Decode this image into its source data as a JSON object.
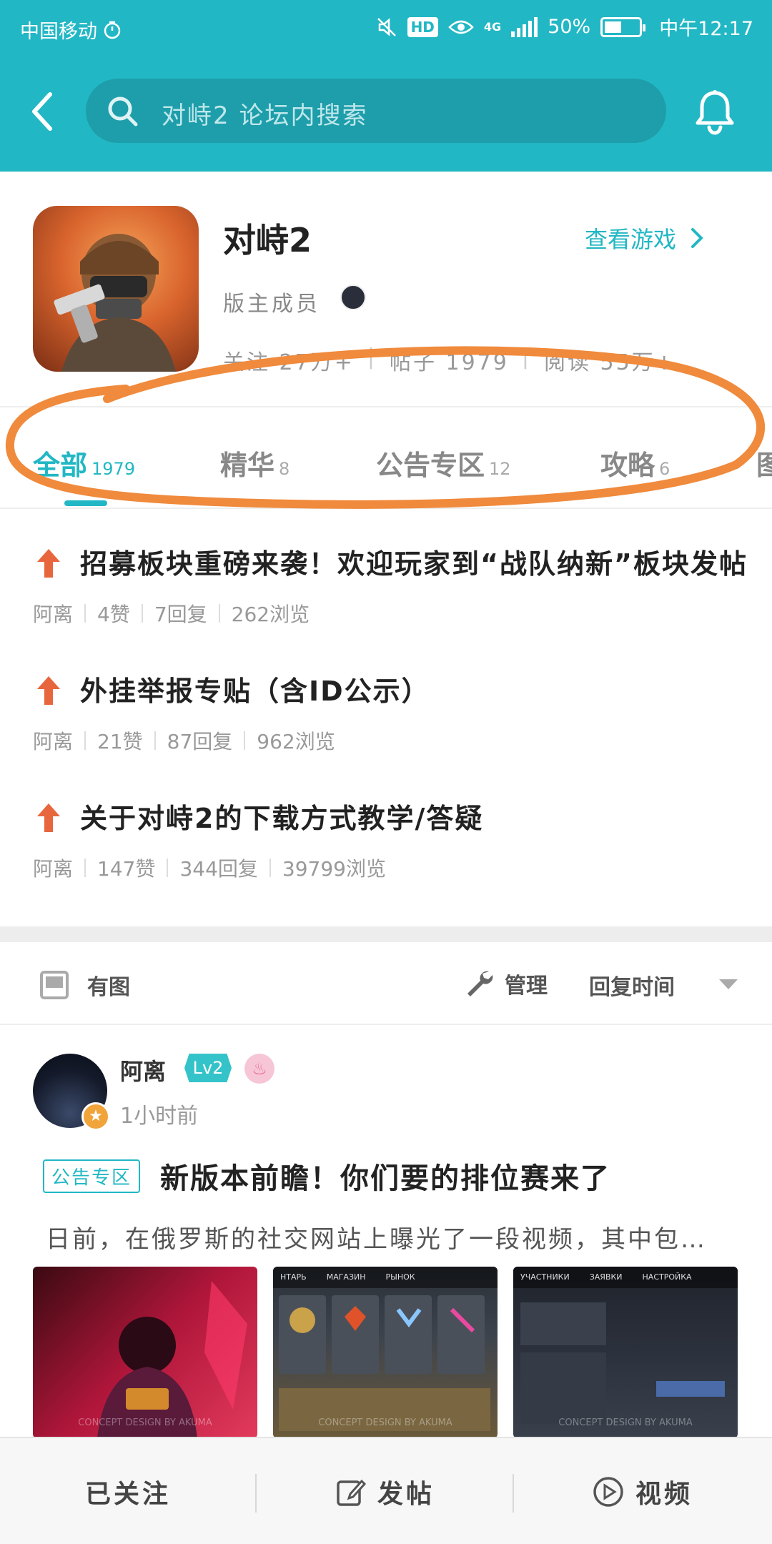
{
  "status_bar": {
    "carrier": "中国移动",
    "network": "4G",
    "battery": "50%",
    "battery_level": 0.5,
    "time": "中午12:17"
  },
  "header": {
    "search_placeholder": "对峙2 论坛内搜索"
  },
  "forum": {
    "title": "对峙2",
    "view_game_label": "查看游戏",
    "moderators_label": "版主成员",
    "stats": [
      "关注 27万+",
      "帖子 1979",
      "阅读 55万+"
    ]
  },
  "tabs": [
    {
      "label": "全部",
      "count": "1979",
      "active": true
    },
    {
      "label": "精华",
      "count": "8",
      "active": false
    },
    {
      "label": "公告专区",
      "count": "12",
      "active": false
    },
    {
      "label": "攻略",
      "count": "6",
      "active": false
    },
    {
      "label": "图",
      "count": "",
      "active": false
    }
  ],
  "pinned": [
    {
      "title": "招募板块重磅来袭！欢迎玩家到“战队纳新”板块发帖",
      "author": "阿离",
      "likes": "4赞",
      "replies": "7回复",
      "views": "262浏览"
    },
    {
      "title": "外挂举报专贴（含ID公示）",
      "author": "阿离",
      "likes": "21赞",
      "replies": "87回复",
      "views": "962浏览"
    },
    {
      "title": "关于对峙2的下载方式教学/答疑",
      "author": "阿离",
      "likes": "147赞",
      "replies": "344回复",
      "views": "39799浏览"
    }
  ],
  "filter": {
    "has_image_label": "有图",
    "manage_label": "管理",
    "sort_label": "回复时间"
  },
  "post": {
    "author": "阿离",
    "level": "Lv2",
    "time": "1小时前",
    "tag": "公告专区",
    "title": "新版本前瞻！你们要的排位赛来了",
    "summary": "日前，在俄罗斯的社交网站上曝光了一段视频，其中包含了新版本的内容",
    "thumbs": [
      {
        "caption": "CONCEPT DESIGN BY AKUMA"
      },
      {
        "caption": "CONCEPT DESIGN BY AKUMA",
        "tabs": [
          "НТАРЬ",
          "МАГАЗИН",
          "РЫНОК"
        ]
      },
      {
        "caption": "CONCEPT DESIGN BY AKUMA",
        "tabs": [
          "УЧАСТНИКИ",
          "ЗАЯВКИ",
          "НАСТРОЙКА"
        ]
      }
    ]
  },
  "bottom_bar": {
    "followed_label": "已关注",
    "post_label": "发帖",
    "video_label": "视频"
  },
  "colors": {
    "accent": "#22b7c4",
    "pin_arrow": "#e8663d",
    "annotation": "#f08a3c"
  }
}
